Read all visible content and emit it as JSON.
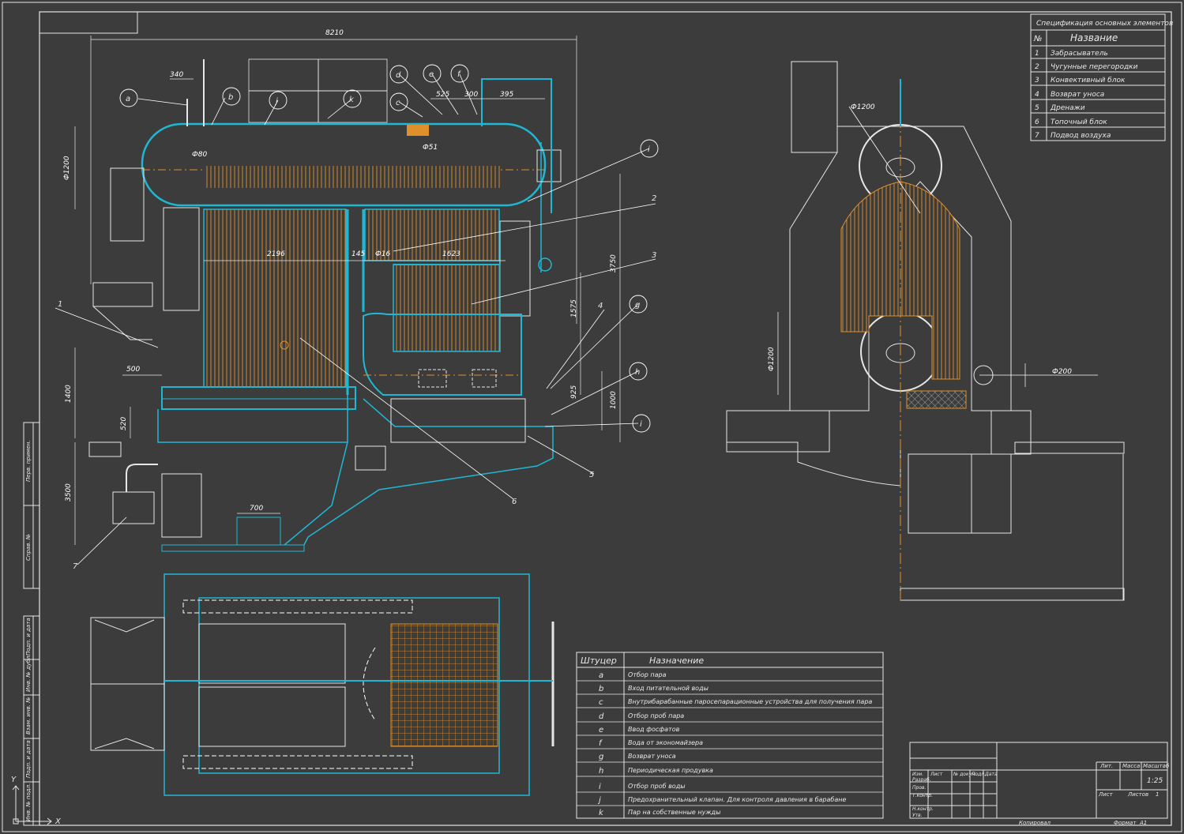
{
  "spec_table": {
    "title": "Спецификация основных элементов",
    "col_no": "№",
    "col_name": "Название",
    "rows": [
      {
        "no": "1",
        "name": "Забрасыватель"
      },
      {
        "no": "2",
        "name": "Чугунные перегородки"
      },
      {
        "no": "3",
        "name": "Конвективный блок"
      },
      {
        "no": "4",
        "name": "Возврат уноса"
      },
      {
        "no": "5",
        "name": "Дренажи"
      },
      {
        "no": "6",
        "name": "Топочный блок"
      },
      {
        "no": "7",
        "name": "Подвод воздуха"
      }
    ]
  },
  "nozzle_table": {
    "col1": "Штуцер",
    "col2": "Назначение",
    "rows": [
      {
        "key": "a",
        "text": "Отбор пара"
      },
      {
        "key": "b",
        "text": "Вход питательной воды"
      },
      {
        "key": "c",
        "text": "Внутрибарабанные паросепарационные устройства для получения пара"
      },
      {
        "key": "d",
        "text": "Отбор проб пара"
      },
      {
        "key": "e",
        "text": "Ввод фосфатов"
      },
      {
        "key": "f",
        "text": "Вода от экономайзера"
      },
      {
        "key": "g",
        "text": "Возврат уноса"
      },
      {
        "key": "h",
        "text": "Периодическая продувка"
      },
      {
        "key": "i",
        "text": "Отбор проб воды"
      },
      {
        "key": "j",
        "text": "Предохранительный клапан. Для контроля давления в барабане"
      },
      {
        "key": "k",
        "text": "Пар на собственные нужды"
      }
    ]
  },
  "title_block": {
    "lit": "Лит.",
    "mass": "Масса",
    "scale_label": "Масштаб",
    "scale": "1:25",
    "sheet": "Лист",
    "sheets": "Листов",
    "sheets_count": "1",
    "copied": "Копировал",
    "format": "Формат",
    "format_value": "A1",
    "stamp_cols": [
      "Изм.",
      "Лист",
      "№ докум.",
      "Подп.",
      "Дата"
    ],
    "stamp_rows": [
      "Разраб.",
      "Пров.",
      "Т.контр.",
      "Н.контр.",
      "Утв."
    ]
  },
  "side_stamp": [
    "Перв. примен.",
    "Справ. №",
    "Подп. и дата",
    "Инв. № дубл.",
    "Взам. инв. №",
    "Подп. и дата",
    "Инв. № подл."
  ],
  "dimensions": {
    "d8210": "8210",
    "d340": "340",
    "d80": "Ф80",
    "d1200": "Ф1200",
    "d525": "525",
    "d300": "300",
    "d395": "395",
    "d51": "Ф51",
    "d2196": "2196",
    "d145": "145",
    "d16": "Ф16",
    "d1623": "1623",
    "d3750": "3750",
    "d1575": "1575",
    "d500": "500",
    "d1400": "1400",
    "d520": "520",
    "d3500": "3500",
    "d700": "700",
    "d925": "925",
    "d1000": "1000",
    "s1200a": "Ф1200",
    "s1200b": "Ф1200",
    "s200": "Ф200"
  },
  "callouts": {
    "a": "a",
    "b": "b",
    "j": "j",
    "k": "k",
    "d": "d",
    "e": "e",
    "f": "f",
    "c": "c",
    "i1": "i",
    "g": "g",
    "h": "h",
    "i2": "i",
    "n1": "1",
    "n2": "2",
    "n3": "3",
    "n4": "4",
    "n5": "5",
    "n6": "6",
    "n7": "7"
  },
  "ucs": {
    "x": "X",
    "y": "Y"
  }
}
